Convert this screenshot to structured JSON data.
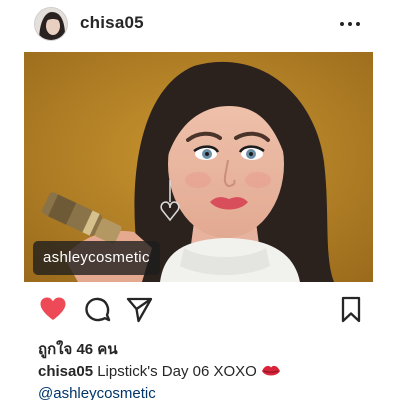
{
  "post": {
    "username": "chisa05",
    "photo_tag": "ashleycosmetic",
    "likes_text": "ถูกใจ 46 คน",
    "caption": {
      "username": "chisa05",
      "text": "Lipstick's Day 06 XOXO",
      "emoji": "lips-kiss-icon",
      "mention": "@ashleycosmetic"
    }
  },
  "icons": {
    "more": "more-options-icon",
    "like": "heart-icon",
    "comment": "comment-icon",
    "share": "send-icon",
    "save": "bookmark-icon"
  },
  "colors": {
    "like_active": "#ed4956",
    "text": "#262626",
    "mention": "#003569",
    "photo_background": "#b9832a"
  }
}
